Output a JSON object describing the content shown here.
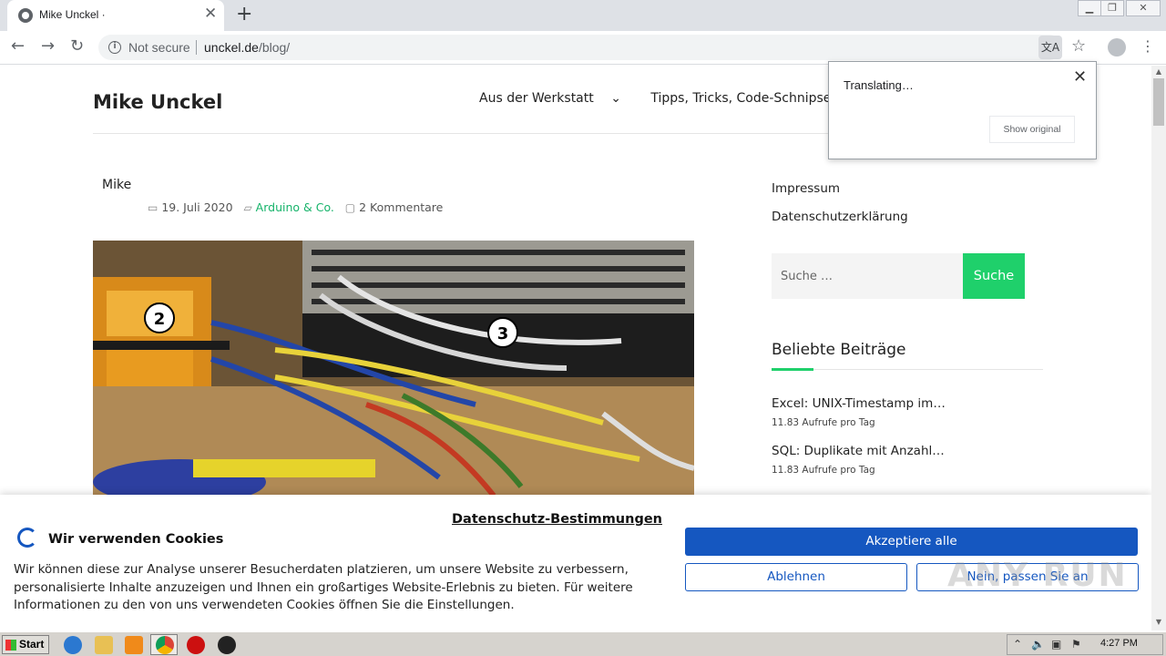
{
  "browser": {
    "tab_title": "Mike Unckel ·",
    "not_secure": "Not secure",
    "url_domain": "unckel.de",
    "url_path": "/blog/"
  },
  "site": {
    "title": "Mike Unckel",
    "nav": [
      "Aus der Werkstatt",
      "Tipps, Tricks, Code-Schnipsel"
    ]
  },
  "post": {
    "author": "Mike",
    "date": "19. Juli 2020",
    "category": "Arduino & Co.",
    "comments": "2 Kommentare",
    "image_labels": [
      "2",
      "3"
    ]
  },
  "sidebar": {
    "links": [
      "Impressum",
      "Datenschutzerklärung"
    ],
    "search_placeholder": "Suche …",
    "search_button": "Suche",
    "popular_title": "Beliebte Beiträge",
    "popular": [
      {
        "title": "Excel: UNIX-Timestamp im…",
        "views": "11.83 Aufrufe pro Tag"
      },
      {
        "title": "SQL: Duplikate mit Anzahl…",
        "views": "11.83 Aufrufe pro Tag"
      }
    ]
  },
  "translate_popup": {
    "status": "Translating…",
    "show_original": "Show original"
  },
  "cookie": {
    "title": "Wir verwenden Cookies",
    "privacy_link": "Datenschutz-Bestimmungen",
    "text": "Wir können diese zur Analyse unserer Besucherdaten platzieren, um unsere Website zu verbessern, personalisierte Inhalte anzuzeigen und Ihnen ein großartiges Website-Erlebnis zu bieten. Für weitere Informationen zu den von uns verwendeten Cookies öffnen Sie die Einstellungen.",
    "accept_all": "Akzeptiere alle",
    "decline": "Ablehnen",
    "customize": "Nein, passen Sie an"
  },
  "watermark": "ANY RUN",
  "taskbar": {
    "start": "Start",
    "clock": "4:27 PM"
  },
  "colors": {
    "accent_green": "#1fd06b",
    "cookie_blue": "#1557c0"
  }
}
